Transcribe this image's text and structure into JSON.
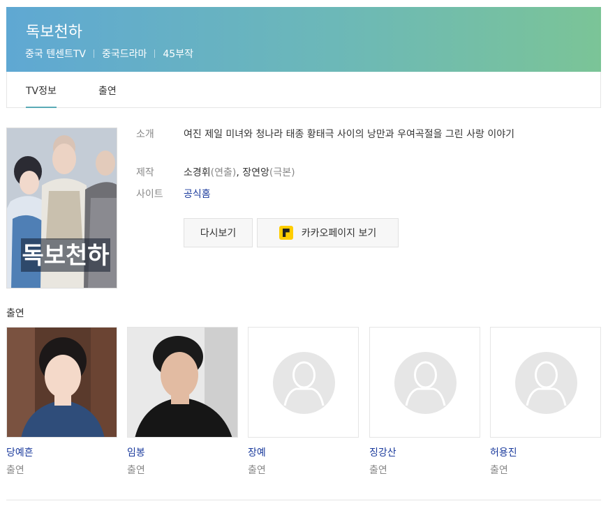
{
  "header": {
    "title": "독보천하",
    "meta": [
      "중국 텐센트TV",
      "중국드라마",
      "45부작"
    ]
  },
  "tabs": [
    {
      "label": "TV정보",
      "active": true
    },
    {
      "label": "출연",
      "active": false
    }
  ],
  "poster": {
    "title_text": "독보천하"
  },
  "info": {
    "intro_label": "소개",
    "intro_value": "여진 제일 미녀와 청나라 태종 황태극 사이의 낭만과 우여곡절을 그린 사랑 이야기",
    "production_label": "제작",
    "director": "소경휘",
    "director_role": "(연출)",
    "writer": "장연앙",
    "writer_role": "(극본)",
    "site_label": "사이트",
    "site_link": "공식홈"
  },
  "buttons": {
    "rewatch": "다시보기",
    "kakao": "카카오페이지 보기"
  },
  "cast_section": {
    "title": "출연",
    "members": [
      {
        "name": "당예흔",
        "role": "출연",
        "has_photo": true
      },
      {
        "name": "임봉",
        "role": "출연",
        "has_photo": true
      },
      {
        "name": "장예",
        "role": "출연",
        "has_photo": false
      },
      {
        "name": "징강산",
        "role": "출연",
        "has_photo": false
      },
      {
        "name": "허용진",
        "role": "출연",
        "has_photo": false
      }
    ]
  },
  "colors": {
    "link": "#1a3a9c",
    "accent": "#5aaab6",
    "kakao_yellow": "#ffcd00"
  }
}
